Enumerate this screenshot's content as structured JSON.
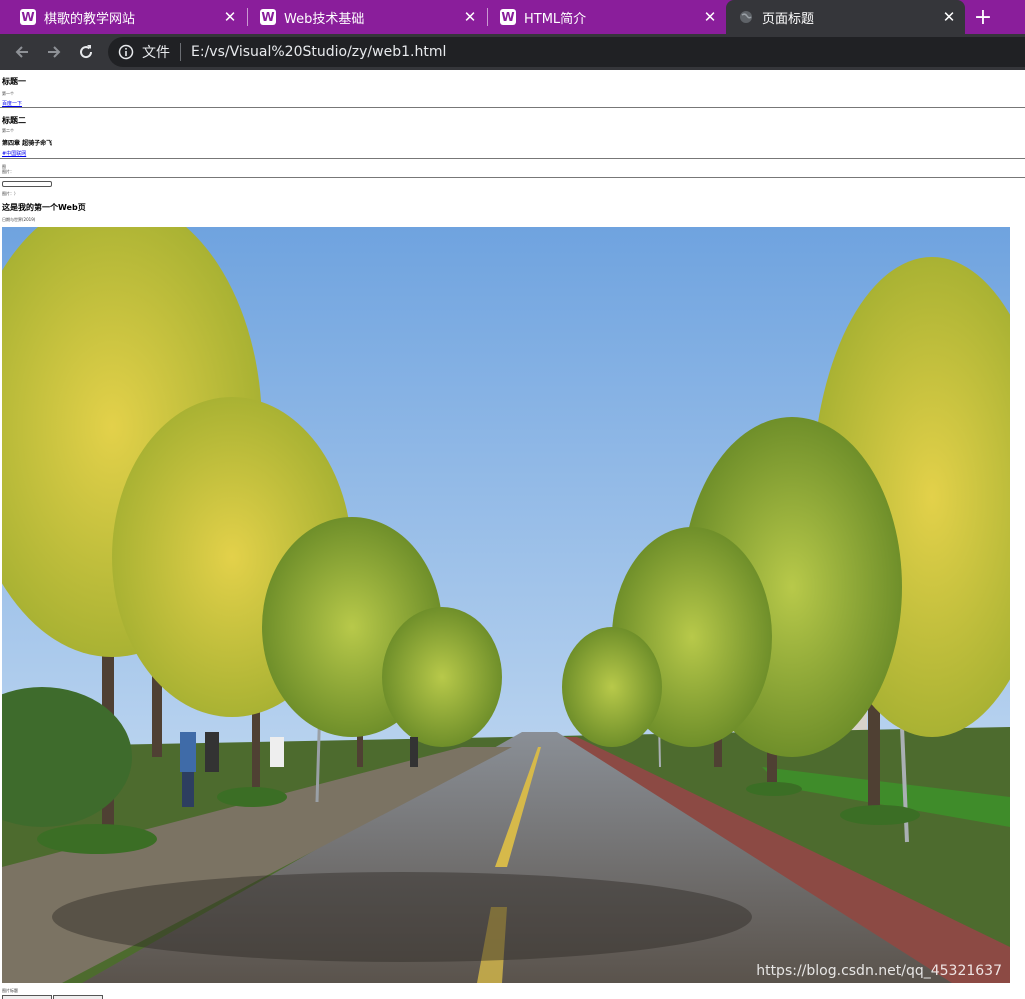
{
  "browser": {
    "tabs": [
      {
        "favicon": "W",
        "title": "棋歌的教学网站"
      },
      {
        "favicon": "W",
        "title": "Web技术基础"
      },
      {
        "favicon": "W",
        "title": "HTML简介"
      },
      {
        "favicon": "globe-icon",
        "title": "页面标题"
      }
    ],
    "address": {
      "scheme_label": "文件",
      "url": "E:/vs/Visual%20Studio/zy/web1.html"
    },
    "colors": {
      "tabstrip": "#8a1e9b",
      "toolbar": "#35363a",
      "omnibox": "#202124"
    }
  },
  "page": {
    "heading1": "标题一",
    "para1": "第一个",
    "link1": "百度一下",
    "heading2": "标题二",
    "para2": "第二个",
    "heading3": "第四章 超骑子命飞",
    "link2": "#中国联网",
    "small1": "图",
    "small2": "图片：",
    "small3": "图片：）",
    "main_title": "这是我的第一个Web页",
    "subtitle": "日期与世界(2019)",
    "bottom_text": "图片标题",
    "watermark": "https://blog.csdn.net/qq_45321637"
  }
}
